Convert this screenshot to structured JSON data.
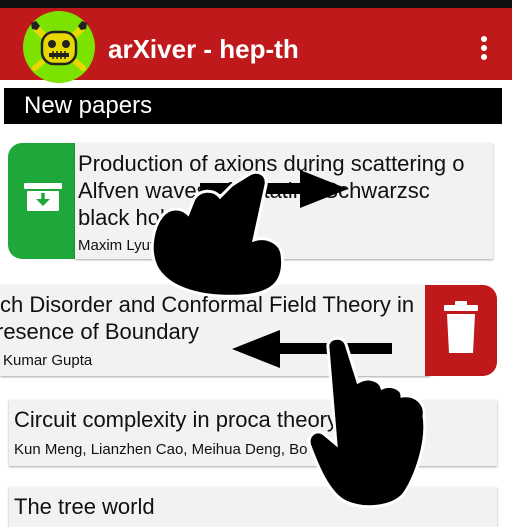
{
  "app": {
    "title": "arXiver - hep-th"
  },
  "section": {
    "title": "New papers"
  },
  "papers": [
    {
      "title_lines": [
        "Production of axions during scattering o",
        "Alfven waves off rotating Schwarzsc",
        "black holes"
      ],
      "authors": "Maxim Lyutikov"
    },
    {
      "title_lines": [
        "ch Disorder and Conformal Field Theory in",
        "resence of Boundary"
      ],
      "authors": "Kumar Gupta"
    },
    {
      "title_lines": [
        "Circuit complexity in proca theory"
      ],
      "authors": "Kun Meng, Lianzhen Cao, Meihua Deng, Bo Wang, Yao"
    },
    {
      "title_lines": [
        "The tree world"
      ],
      "authors": ""
    }
  ],
  "colors": {
    "primary": "#c0191c",
    "archive": "#1fa83a",
    "logo": "#7ce300",
    "header_bg": "#000000"
  },
  "icons": {
    "archive": "archive-icon",
    "delete": "trash-icon",
    "menu": "overflow-menu-icon",
    "logo": "android-robot-icon"
  }
}
